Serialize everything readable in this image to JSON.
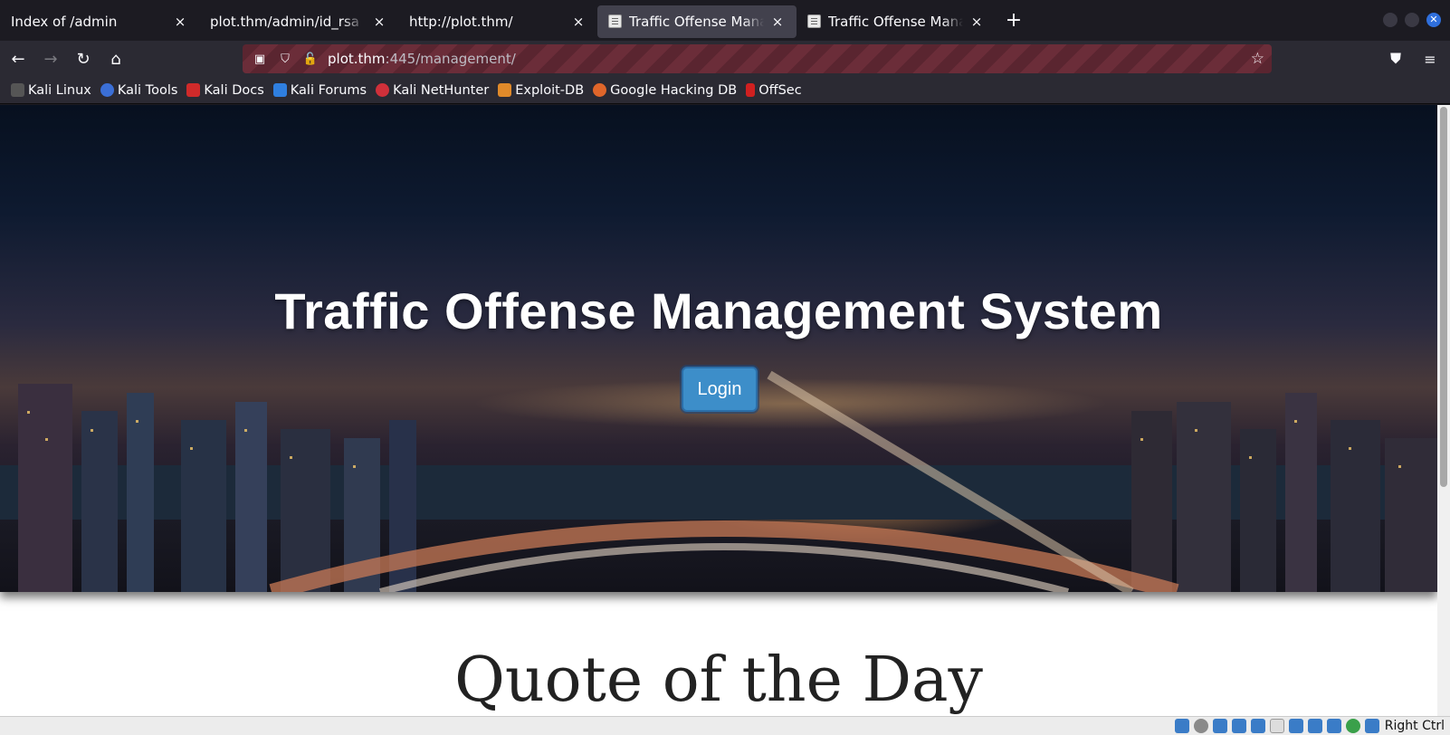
{
  "tabs": [
    {
      "title": "Index of /admin",
      "active": false,
      "favicon": false
    },
    {
      "title": "plot.thm/admin/id_rsa",
      "active": false,
      "favicon": false
    },
    {
      "title": "http://plot.thm/",
      "active": false,
      "favicon": false
    },
    {
      "title": "Traffic Offense Management System",
      "active": true,
      "favicon": true
    },
    {
      "title": "Traffic Offense Management System",
      "active": false,
      "favicon": true
    }
  ],
  "tab_close_glyph": "×",
  "new_tab_glyph": "+",
  "nav": {
    "back_icon": "arrow-left-icon",
    "forward_icon": "arrow-right-icon",
    "reload_icon": "reload-icon",
    "home_icon": "home-icon"
  },
  "url": {
    "host": "plot.thm",
    "rest": ":445/management/"
  },
  "bookmarks": [
    {
      "label": "Kali Linux",
      "color": "#444444"
    },
    {
      "label": "Kali Tools",
      "color": "#3b6fd6"
    },
    {
      "label": "Kali Docs",
      "color": "#d02a2a"
    },
    {
      "label": "Kali Forums",
      "color": "#2f7fe0"
    },
    {
      "label": "Kali NetHunter",
      "color": "#d0303a"
    },
    {
      "label": "Exploit-DB",
      "color": "#e08a2a"
    },
    {
      "label": "Google Hacking DB",
      "color": "#e0662a"
    },
    {
      "label": "OffSec",
      "color": "#d02020"
    }
  ],
  "page": {
    "hero_title": "Traffic Offense Management System",
    "login_label": "Login",
    "quote_heading": "Quote of the Day"
  },
  "statusbar": {
    "host_key": "Right Ctrl"
  },
  "colors": {
    "accent": "#3d8ec9",
    "url_stripe": "#6b2d39",
    "tab_active": "#42414d"
  }
}
